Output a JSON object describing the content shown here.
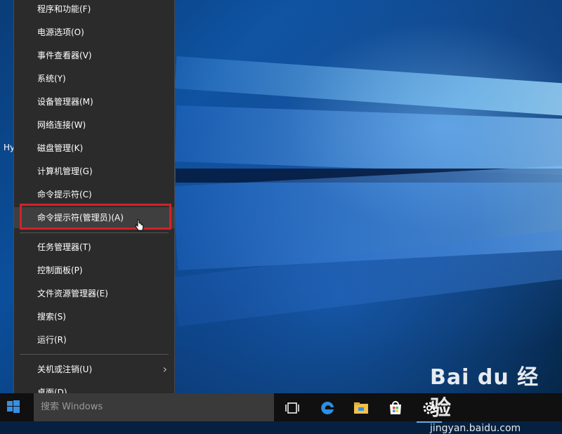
{
  "desktop": {
    "icon_label": "Hy"
  },
  "menu": {
    "items": [
      {
        "label": "程序和功能(F)"
      },
      {
        "label": "电源选项(O)"
      },
      {
        "label": "事件查看器(V)"
      },
      {
        "label": "系统(Y)"
      },
      {
        "label": "设备管理器(M)"
      },
      {
        "label": "网络连接(W)"
      },
      {
        "label": "磁盘管理(K)"
      },
      {
        "label": "计算机管理(G)"
      },
      {
        "label": "命令提示符(C)"
      },
      {
        "label": "命令提示符(管理员)(A)",
        "highlighted": true
      },
      {
        "label": "任务管理器(T)"
      },
      {
        "label": "控制面板(P)"
      },
      {
        "label": "文件资源管理器(E)"
      },
      {
        "label": "搜索(S)"
      },
      {
        "label": "运行(R)"
      },
      {
        "label": "关机或注销(U)",
        "has_submenu": true
      },
      {
        "label": "桌面(D)"
      }
    ],
    "highlight_color": "#d0242a"
  },
  "taskbar": {
    "search_placeholder": "搜索 Windows",
    "icons": [
      "task-view-icon",
      "edge-icon",
      "file-explorer-icon",
      "store-icon",
      "settings-icon"
    ]
  },
  "watermark": {
    "logo": "Bai du 经验",
    "url": "jingyan.baidu.com"
  }
}
